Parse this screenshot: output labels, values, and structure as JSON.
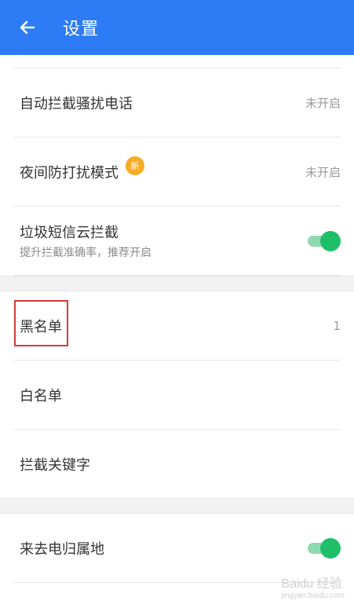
{
  "header": {
    "title": "设置",
    "back_icon": "arrow-left-icon"
  },
  "items": [
    {
      "title": "自动拦截骚扰电话",
      "value": "未开启"
    },
    {
      "title": "夜间防打扰模式",
      "badge": "新",
      "value": "未开启"
    },
    {
      "title": "垃圾短信云拦截",
      "subtitle": "提升拦截准确率，推荐开启",
      "toggle": true
    },
    {
      "title": "黑名单",
      "value": "1"
    },
    {
      "title": "白名单"
    },
    {
      "title": "拦截关键字"
    },
    {
      "title": "来去电归属地",
      "toggle": true
    }
  ],
  "watermark": {
    "brand": "Baidu 经验",
    "url": "jingyan.baidu.com"
  },
  "colors": {
    "appbar": "#2d7cf6",
    "toggle_on": "#1fbf69",
    "badge": "#f6ac25",
    "highlight": "#d23b3b"
  }
}
